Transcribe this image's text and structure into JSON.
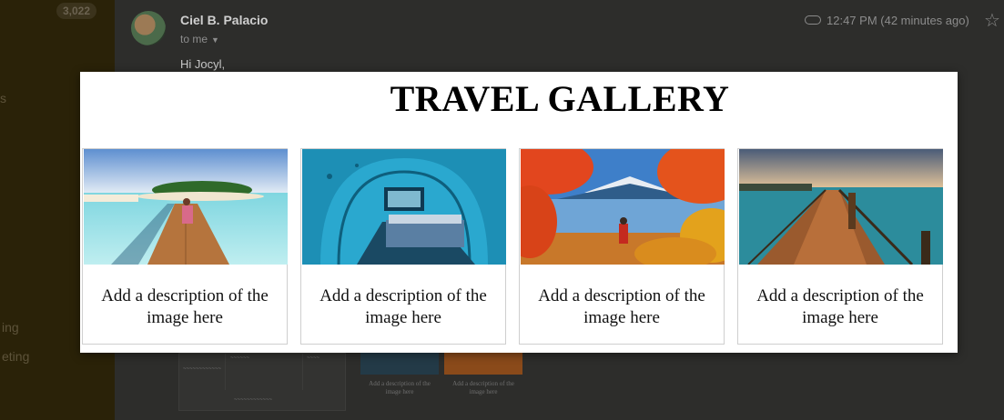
{
  "email": {
    "unread_count": "3,022",
    "sender": "Ciel B. Palacio",
    "recipient": "to me",
    "time": "12:47 PM (42 minutes ago)",
    "greeting": "Hi Jocyl,"
  },
  "sidebar": {
    "fragments": [
      "s",
      "ing",
      "eting"
    ]
  },
  "gallery": {
    "title": "TRAVEL GALLERY",
    "cards": [
      {
        "description": "Add a description of the image here",
        "image": "tropical-island-pier"
      },
      {
        "description": "Add a description of the image here",
        "image": "underwater-bedroom"
      },
      {
        "description": "Add a description of the image here",
        "image": "autumn-mountain-lake"
      },
      {
        "description": "Add a description of the image here",
        "image": "overwater-boardwalk-sunset"
      }
    ]
  },
  "preview": {
    "captions": [
      "Add a description of the image here",
      "Add a description of the image here"
    ]
  },
  "colors": {
    "overlay_bg": "#2b2a27",
    "modal_bg": "#ffffff",
    "title": "#000000"
  }
}
